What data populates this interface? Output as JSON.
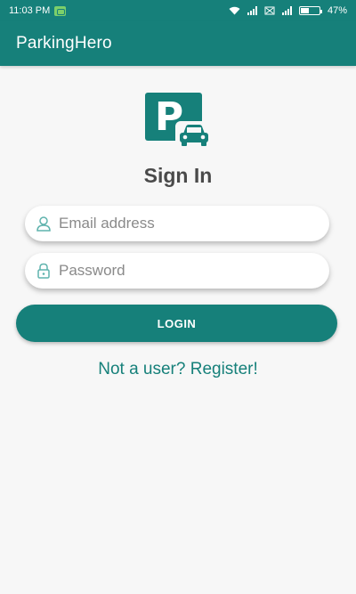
{
  "status_bar": {
    "time": "11:03 PM",
    "battery": "47%"
  },
  "app_bar": {
    "title": "ParkingHero"
  },
  "logo": {
    "letter": "P",
    "icon": "parking-car-logo"
  },
  "sign_in": {
    "title": "Sign In",
    "email_placeholder": "Email address",
    "password_placeholder": "Password",
    "login_label": "LOGIN",
    "register_link": "Not a user? Register!"
  },
  "colors": {
    "primary": "#16807a",
    "background": "#f7f7f7",
    "title_text": "#4a4a4a"
  }
}
